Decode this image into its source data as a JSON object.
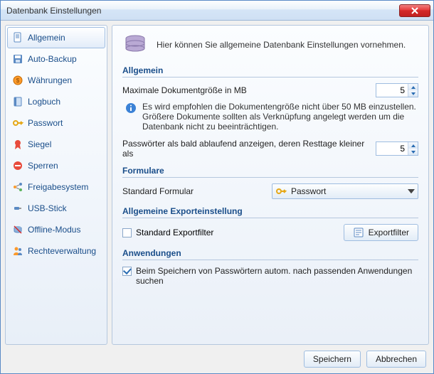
{
  "window": {
    "title": "Datenbank Einstellungen"
  },
  "sidebar": {
    "items": [
      {
        "label": "Allgemein"
      },
      {
        "label": "Auto-Backup"
      },
      {
        "label": "Währungen"
      },
      {
        "label": "Logbuch"
      },
      {
        "label": "Passwort"
      },
      {
        "label": "Siegel"
      },
      {
        "label": "Sperren"
      },
      {
        "label": "Freigabesystem"
      },
      {
        "label": "USB-Stick"
      },
      {
        "label": "Offline-Modus"
      },
      {
        "label": "Rechteverwaltung"
      }
    ]
  },
  "intro": "Hier können Sie allgemeine Datenbank Einstellungen vornehmen.",
  "section_general": "Allgemein",
  "max_doc_label": "Maximale Dokumentgröße in MB",
  "max_doc_value": "5",
  "info_text": "Es wird empfohlen die Dokumentengröße nicht über 50 MB einzustellen. Größere Dokumente sollten als Verknüpfung angelegt werden um die Datenbank nicht zu beeinträchtigen.",
  "passwords_label": "Passwörter als bald ablaufend anzeigen, deren Resttage kleiner als",
  "passwords_value": "5",
  "section_forms": "Formulare",
  "form_label": "Standard Formular",
  "form_value": "Passwort",
  "section_export": "Allgemeine Exporteinstellung",
  "export_checkbox_label": "Standard Exportfilter",
  "export_button": "Exportfilter",
  "section_apps": "Anwendungen",
  "apps_checkbox_label": "Beim Speichern von Passwörtern autom. nach passenden Anwendungen suchen",
  "footer": {
    "save": "Speichern",
    "cancel": "Abbrechen"
  },
  "colors": {
    "accent": "#1a4e8a"
  }
}
